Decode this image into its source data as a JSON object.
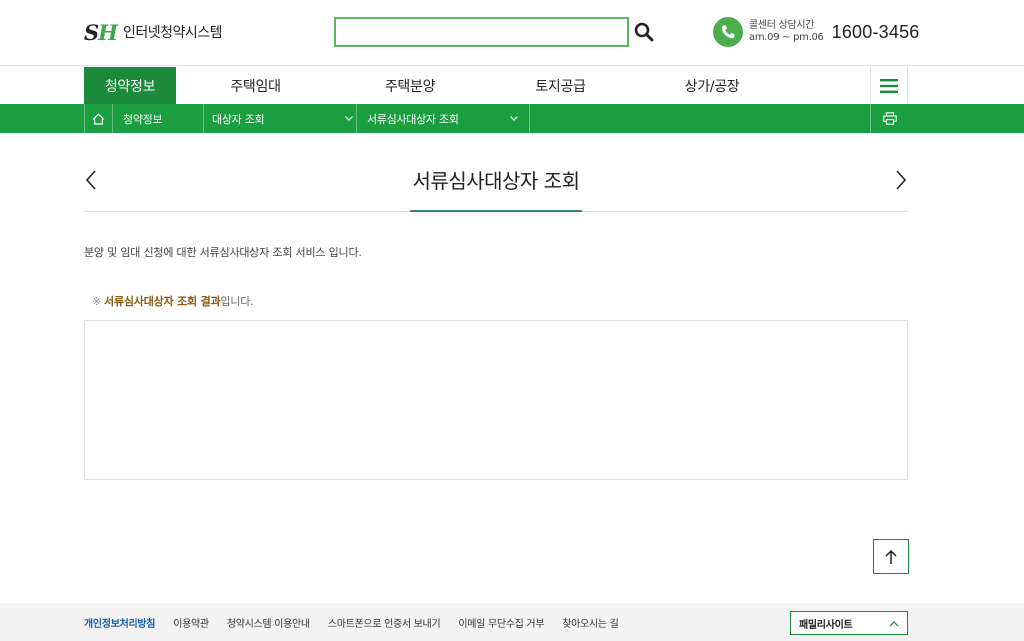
{
  "header": {
    "logo_mark_s": "S",
    "logo_mark_h": "H",
    "logo_text": "인터넷청약시스템",
    "search_placeholder": "",
    "search_value": "",
    "callcenter_label": "콜센터 상담시간",
    "callcenter_hours": "am.09 ~ pm.06",
    "callcenter_number": "1600-3456"
  },
  "gnb": {
    "items": [
      "청약정보",
      "주택임대",
      "주택분양",
      "토지공급",
      "상가/공장"
    ],
    "active_index": 0
  },
  "breadcrumb": {
    "level1": "청약정보",
    "level2": "대상자 조회",
    "level3": "서류심사대상자 조회"
  },
  "main": {
    "page_title": "서류심사대상자 조회",
    "description": "분양 및 임대 신청에 대한 서류심사대상자 조회 서비스 입니다.",
    "note_mark": "※",
    "note_highlight": "서류심사대상자 조회 결과",
    "note_suffix": "입니다."
  },
  "footer": {
    "links": [
      "개인정보처리방침",
      "이용약관",
      "청약시스템 이용안내",
      "스마트폰으로 인증서 보내기",
      "이메일 무단수집 거부",
      "찾아오시는 길"
    ],
    "family_site_label": "패밀리사이트"
  },
  "colors": {
    "primary_green": "#1b8a3b",
    "bar_green": "#1a9e40",
    "search_border": "#5cb85c",
    "title_underline": "#2f8a7a",
    "highlight_brown": "#8a5a10",
    "privacy_link_blue": "#1b5fa8"
  }
}
